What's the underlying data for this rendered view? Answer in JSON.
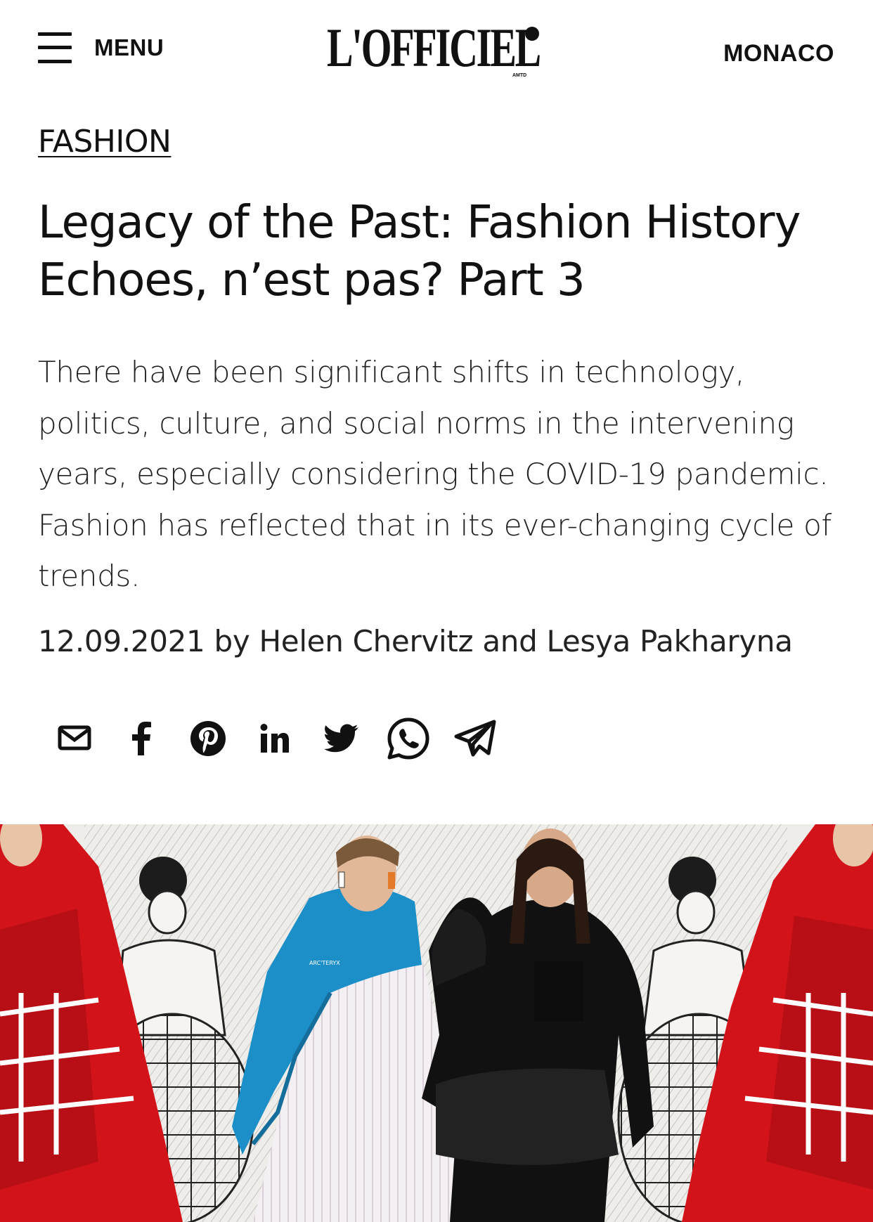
{
  "header": {
    "menu_label": "MENU",
    "logo_text": "L'OFFICIEL",
    "logo_subtext": "AMTD",
    "edition": "MONACO"
  },
  "article": {
    "category": "FASHION",
    "title": "Legacy of the Past: Fashion History Echoes, n’est pas? Part 3",
    "lede": "There have been significant shifts in technology, politics, culture, and social norms in the intervening years, especially considering the COVID-19 pandemic. Fashion has reflected that in its ever-changing cycle of trends.",
    "byline": "12.09.2021 by Helen Chervitz and Lesya Pakharyna"
  },
  "share": [
    {
      "icon": "email-icon"
    },
    {
      "icon": "facebook-icon"
    },
    {
      "icon": "pinterest-icon"
    },
    {
      "icon": "linkedin-icon"
    },
    {
      "icon": "twitter-icon"
    },
    {
      "icon": "whatsapp-icon"
    },
    {
      "icon": "telegram-icon"
    }
  ],
  "hero": {
    "jacket_brand_text": "ARC'TERYX"
  },
  "colors": {
    "text": "#111111",
    "accent_red": "#d2141a",
    "accent_blue": "#1c8fc8",
    "background": "#ffffff"
  }
}
